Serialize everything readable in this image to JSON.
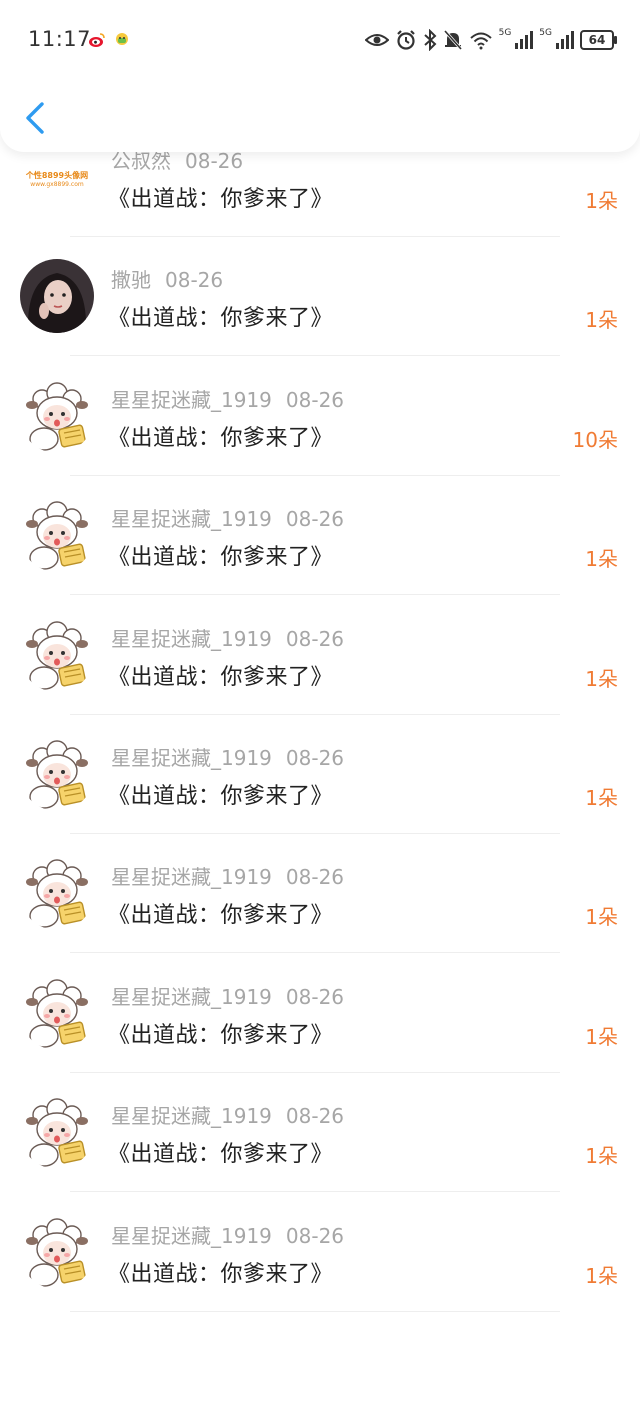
{
  "status_bar": {
    "time": "11:17",
    "app_icons": [
      "weibo-icon",
      "chat-app-icon"
    ],
    "signal_label_1": "5G",
    "signal_label_2": "5G",
    "battery": "64",
    "icons": [
      "eye-icon",
      "alarm-icon",
      "bluetooth-icon",
      "mute-bell-icon",
      "wifi-icon",
      "signal-icon",
      "signal-icon",
      "battery-icon"
    ]
  },
  "header": {
    "back_icon": "chevron-left-icon"
  },
  "colors": {
    "accent": "#f07b34",
    "back": "#2e9bf0",
    "muted": "#a6a6a6",
    "title": "#222222"
  },
  "rows": [
    {
      "user": "",
      "date": "",
      "title": "《出道战：你爹来了》",
      "count": "10朵",
      "avatar": "dark-portrait"
    },
    {
      "user": "公叔然",
      "date": "08-26",
      "title": "《出道战：你爹来了》",
      "count": "1朵",
      "avatar": "text-logo",
      "avatar_text_top": "个性8899头像网",
      "avatar_text_bottom": "www.gx8899.com"
    },
    {
      "user": "撒驰",
      "date": "08-26",
      "title": "《出道战：你爹来了》",
      "count": "1朵",
      "avatar": "girl-portrait"
    },
    {
      "user": "星星捉迷藏_1919",
      "date": "08-26",
      "title": "《出道战：你爹来了》",
      "count": "10朵",
      "avatar": "sheep"
    },
    {
      "user": "星星捉迷藏_1919",
      "date": "08-26",
      "title": "《出道战：你爹来了》",
      "count": "1朵",
      "avatar": "sheep"
    },
    {
      "user": "星星捉迷藏_1919",
      "date": "08-26",
      "title": "《出道战：你爹来了》",
      "count": "1朵",
      "avatar": "sheep"
    },
    {
      "user": "星星捉迷藏_1919",
      "date": "08-26",
      "title": "《出道战：你爹来了》",
      "count": "1朵",
      "avatar": "sheep"
    },
    {
      "user": "星星捉迷藏_1919",
      "date": "08-26",
      "title": "《出道战：你爹来了》",
      "count": "1朵",
      "avatar": "sheep"
    },
    {
      "user": "星星捉迷藏_1919",
      "date": "08-26",
      "title": "《出道战：你爹来了》",
      "count": "1朵",
      "avatar": "sheep"
    },
    {
      "user": "星星捉迷藏_1919",
      "date": "08-26",
      "title": "《出道战：你爹来了》",
      "count": "1朵",
      "avatar": "sheep"
    },
    {
      "user": "星星捉迷藏_1919",
      "date": "08-26",
      "title": "《出道战：你爹来了》",
      "count": "1朵",
      "avatar": "sheep"
    }
  ]
}
